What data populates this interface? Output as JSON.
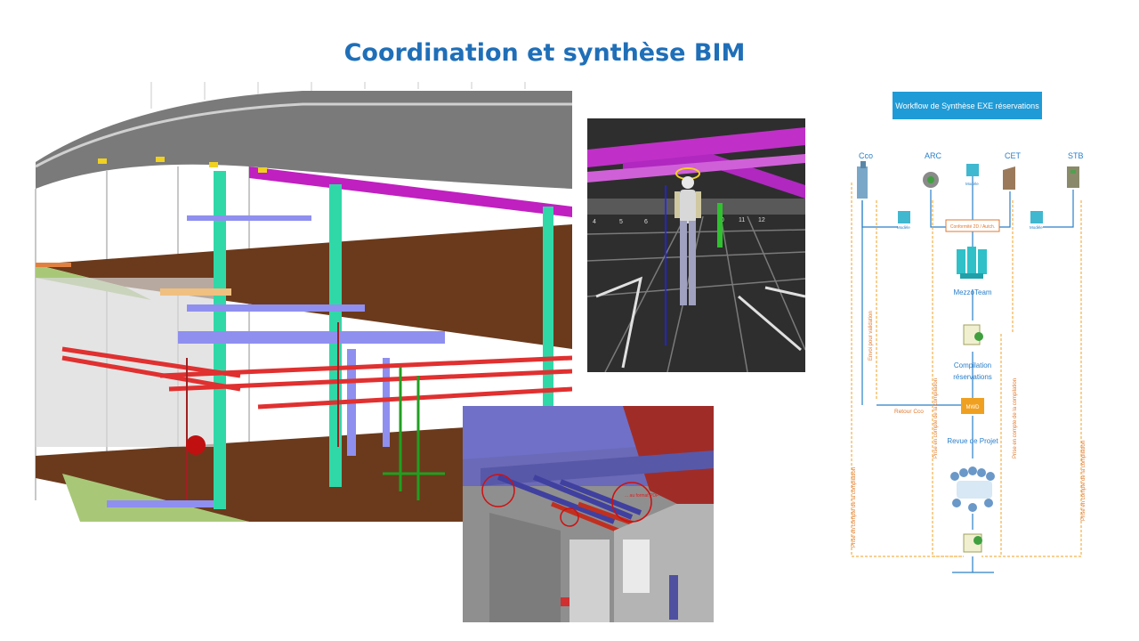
{
  "slide": {
    "title": "Coordination et synthèse BIM"
  },
  "colors": {
    "title": "#1f6fb8",
    "workflow_header": "#1f9bd7",
    "workflow_line": "#2a7fc8",
    "workflow_dashed": "#f0a020"
  },
  "images": {
    "main_model": {
      "label": "BIM building section model"
    },
    "avatar_view": {
      "grid_labels": [
        "4",
        "5",
        "6",
        "10",
        "11",
        "12"
      ]
    },
    "corridor_view": {
      "annotation": "... au format PDF"
    }
  },
  "workflow": {
    "header": "Workflow de Synthèse EXE réservations",
    "actors": [
      "Cco",
      "ARC",
      "CET",
      "STB"
    ],
    "model_label": "Modèle",
    "conformity": "Conformité 2D / Autch.",
    "mezzoteam": "MezzoTeam",
    "compilation": [
      "Compilation",
      "réservations"
    ],
    "mwd": "MWD",
    "retour": "Retour Cco",
    "revue": "Revue de Projet",
    "envoi": "Envoi pour validation",
    "prise": "Prise en compte de la compilation"
  }
}
